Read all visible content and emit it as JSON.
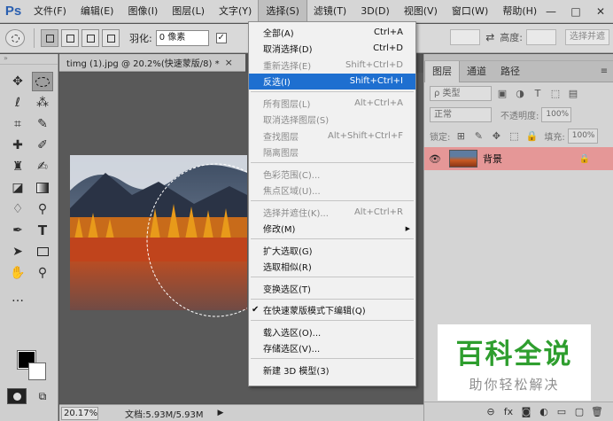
{
  "menubar": {
    "logo": "Ps",
    "items": [
      "文件(F)",
      "编辑(E)",
      "图像(I)",
      "图层(L)",
      "文字(Y)",
      "选择(S)",
      "滤镜(T)",
      "3D(D)",
      "视图(V)",
      "窗口(W)",
      "帮助(H)"
    ],
    "active_index": 5,
    "window_buttons": [
      "—",
      "□",
      "✕"
    ]
  },
  "options": {
    "feather_label": "羽化:",
    "feather_value": "0 像素",
    "antialias_check": "✓",
    "height_label": "高度:",
    "select_mask_button": "选择并遮",
    "swap_icon": "⇄"
  },
  "document": {
    "tab_title": "timg (1).jpg @ 20.2%(快速蒙版/8) *",
    "tab_close": "×"
  },
  "status": {
    "zoom": "20.17%",
    "doc_info": "文档:5.93M/5.93M",
    "arrow": "▶"
  },
  "select_menu": {
    "sections": [
      [
        {
          "label": "全部(A)",
          "shortcut": "Ctrl+A",
          "disabled": false,
          "highlight": false
        },
        {
          "label": "取消选择(D)",
          "shortcut": "Ctrl+D",
          "disabled": false,
          "highlight": false
        },
        {
          "label": "重新选择(E)",
          "shortcut": "Shift+Ctrl+D",
          "disabled": true,
          "highlight": false
        },
        {
          "label": "反选(I)",
          "shortcut": "Shift+Ctrl+I",
          "disabled": false,
          "highlight": true
        }
      ],
      [
        {
          "label": "所有图层(L)",
          "shortcut": "Alt+Ctrl+A",
          "disabled": true,
          "highlight": false
        },
        {
          "label": "取消选择图层(S)",
          "shortcut": "",
          "disabled": true,
          "highlight": false
        },
        {
          "label": "查找图层",
          "shortcut": "Alt+Shift+Ctrl+F",
          "disabled": true,
          "highlight": false
        },
        {
          "label": "隔离图层",
          "shortcut": "",
          "disabled": true,
          "highlight": false
        }
      ],
      [
        {
          "label": "色彩范围(C)...",
          "shortcut": "",
          "disabled": true,
          "highlight": false
        },
        {
          "label": "焦点区域(U)...",
          "shortcut": "",
          "disabled": true,
          "highlight": false
        }
      ],
      [
        {
          "label": "选择并遮住(K)...",
          "shortcut": "Alt+Ctrl+R",
          "disabled": true,
          "highlight": false
        },
        {
          "label": "修改(M)",
          "shortcut": "",
          "disabled": false,
          "highlight": false,
          "submenu": true
        }
      ],
      [
        {
          "label": "扩大选取(G)",
          "shortcut": "",
          "disabled": false,
          "highlight": false
        },
        {
          "label": "选取相似(R)",
          "shortcut": "",
          "disabled": false,
          "highlight": false
        }
      ],
      [
        {
          "label": "变换选区(T)",
          "shortcut": "",
          "disabled": false,
          "highlight": false
        }
      ],
      [
        {
          "label": "在快速蒙版模式下编辑(Q)",
          "shortcut": "",
          "disabled": false,
          "highlight": false,
          "checked": true
        }
      ],
      [
        {
          "label": "载入选区(O)...",
          "shortcut": "",
          "disabled": false,
          "highlight": false
        },
        {
          "label": "存储选区(V)...",
          "shortcut": "",
          "disabled": false,
          "highlight": false
        }
      ],
      [
        {
          "label": "新建 3D 模型(3)",
          "shortcut": "",
          "disabled": false,
          "highlight": false
        }
      ]
    ]
  },
  "layers_panel": {
    "tabs": [
      "图层",
      "通道",
      "路径"
    ],
    "active_tab": 0,
    "filter_label": "ρ 类型",
    "blend_mode": "正常",
    "opacity_label": "不透明度:",
    "opacity_value": "100%",
    "lock_label": "锁定:",
    "fill_label": "填充:",
    "fill_value": "100%",
    "layer_name": "背景",
    "bottom_icons": [
      "⊖",
      "fx",
      "◙",
      "◐",
      "▭",
      "▢",
      "🗑"
    ]
  },
  "watermark": {
    "title": "百科全说",
    "subtitle": "助你轻松解决"
  }
}
